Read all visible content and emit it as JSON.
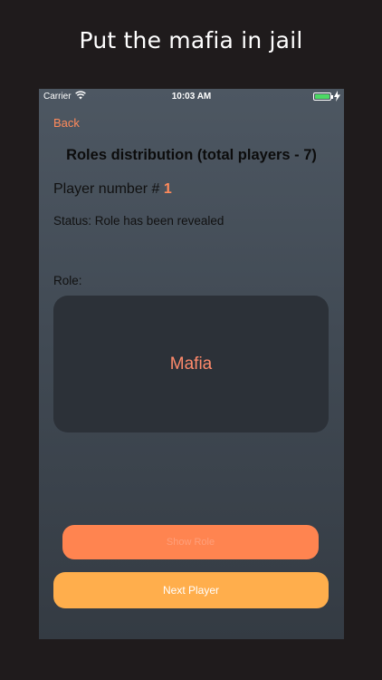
{
  "headline": "Put the mafia in jail",
  "status_bar": {
    "carrier": "Carrier",
    "time": "10:03 AM",
    "icons": [
      "wifi-icon",
      "battery-icon",
      "charging-bolt-icon"
    ]
  },
  "nav": {
    "back_label": "Back"
  },
  "screen": {
    "title": "Roles distribution (total players - 7)",
    "player_label": "Player number # ",
    "player_number": "1",
    "status_text": "Status: Role has been revealed",
    "role_label": "Role:",
    "role_value": "Mafia"
  },
  "buttons": {
    "show_role": "Show Role",
    "next_player": "Next Player"
  },
  "colors": {
    "accent": "#ff8a5b",
    "show_role_button": "#ff8450",
    "next_player_button": "#ffae4c",
    "role_card": "#2c3138",
    "battery": "#4cd964"
  }
}
